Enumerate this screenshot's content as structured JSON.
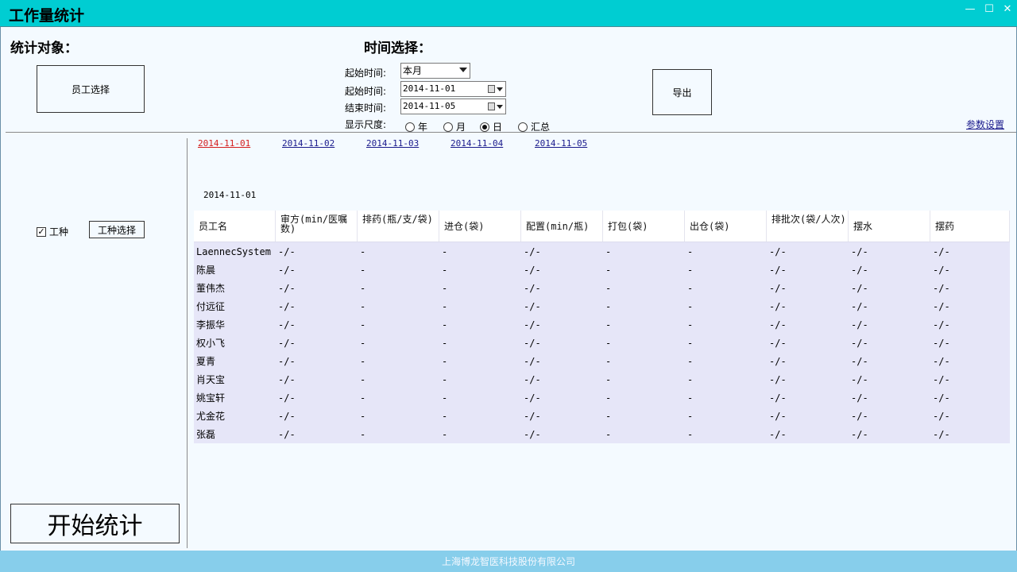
{
  "window": {
    "title": "工作量统计"
  },
  "controls": {
    "minimize": "—",
    "maximize": "☐",
    "close": "✕"
  },
  "left": {
    "heading": "统计对象：",
    "employee_select": "员工选择",
    "worktype_checkbox": {
      "label": "工种",
      "checked": true
    },
    "worktype_select": "工种选择",
    "start_button": "开始统计"
  },
  "time": {
    "heading": "时间选择：",
    "preset_label": "起始时间:",
    "preset_value": "本月",
    "start_label": "起始时间:",
    "start_value": "2014-11-01",
    "end_label": "结束时间:",
    "end_value": "2014-11-05",
    "scale_label": "显示尺度:",
    "scale_options": [
      {
        "label": "年",
        "selected": false
      },
      {
        "label": "月",
        "selected": false
      },
      {
        "label": "日",
        "selected": true
      },
      {
        "label": "汇总",
        "selected": false
      }
    ]
  },
  "export_button": "导出",
  "param_link": "参数设置",
  "date_tabs": [
    "2014-11-01",
    "2014-11-02",
    "2014-11-03",
    "2014-11-04",
    "2014-11-05"
  ],
  "active_date_index": 0,
  "current_date": "2014-11-01",
  "table": {
    "columns": [
      "员工名",
      "审方(min/医嘱数)",
      "排药(瓶/支/袋)",
      "进仓(袋)",
      "配置(min/瓶)",
      "打包(袋)",
      "出仓(袋)",
      "排批次(袋/人次)",
      "摆水",
      "摆药"
    ],
    "rows": [
      [
        "LaennecSystem",
        "-/-",
        "-",
        "-",
        "-/-",
        "-",
        "-",
        "-/-",
        "-/-",
        "-/-"
      ],
      [
        "陈晨",
        "-/-",
        "-",
        "-",
        "-/-",
        "-",
        "-",
        "-/-",
        "-/-",
        "-/-"
      ],
      [
        "董伟杰",
        "-/-",
        "-",
        "-",
        "-/-",
        "-",
        "-",
        "-/-",
        "-/-",
        "-/-"
      ],
      [
        "付远征",
        "-/-",
        "-",
        "-",
        "-/-",
        "-",
        "-",
        "-/-",
        "-/-",
        "-/-"
      ],
      [
        "李振华",
        "-/-",
        "-",
        "-",
        "-/-",
        "-",
        "-",
        "-/-",
        "-/-",
        "-/-"
      ],
      [
        "权小飞",
        "-/-",
        "-",
        "-",
        "-/-",
        "-",
        "-",
        "-/-",
        "-/-",
        "-/-"
      ],
      [
        "夏青",
        "-/-",
        "-",
        "-",
        "-/-",
        "-",
        "-",
        "-/-",
        "-/-",
        "-/-"
      ],
      [
        "肖天宝",
        "-/-",
        "-",
        "-",
        "-/-",
        "-",
        "-",
        "-/-",
        "-/-",
        "-/-"
      ],
      [
        "姚宝轩",
        "-/-",
        "-",
        "-",
        "-/-",
        "-",
        "-",
        "-/-",
        "-/-",
        "-/-"
      ],
      [
        "尤金花",
        "-/-",
        "-",
        "-",
        "-/-",
        "-",
        "-",
        "-/-",
        "-/-",
        "-/-"
      ],
      [
        "张磊",
        "-/-",
        "-",
        "-",
        "-/-",
        "-",
        "-",
        "-/-",
        "-/-",
        "-/-"
      ]
    ]
  },
  "footer": "上海博龙智医科技股份有限公司",
  "colors": {
    "titlebar": "#00cdd2",
    "footer": "#87ceeb",
    "row_bg": "#e6e6f8",
    "active_link": "#d41e1e",
    "link": "#1a1a8c"
  }
}
